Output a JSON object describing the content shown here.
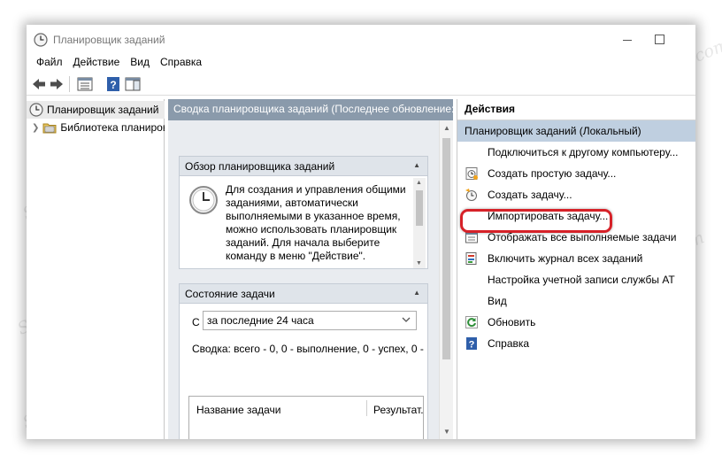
{
  "window": {
    "title": "Планировщик заданий"
  },
  "menubar": {
    "items": [
      "Файл",
      "Действие",
      "Вид",
      "Справка"
    ]
  },
  "toolbar": {
    "buttons": [
      "back-arrow-icon",
      "forward-arrow-icon",
      "console-tree-icon",
      "help-icon",
      "action-pane-icon"
    ]
  },
  "tree": {
    "root_label": "Планировщик заданий",
    "library_label": "Библиотека планировщика заданий"
  },
  "center": {
    "header": "Сводка планировщика заданий (Последнее обновление:",
    "overview": {
      "title": "Обзор планировщика заданий",
      "description": "Для создания и управления общими заданиями, автоматически выполняемыми в указанное время, можно использовать планировщик заданий. Для начала выберите команду в меню \"Действие\"."
    },
    "status": {
      "title": "Состояние задачи",
      "period_label": "С",
      "period_value": "за последние 24 часа",
      "summary": "Сводка: всего - 0, 0 - выполнение, 0 - успех, 0 -",
      "columns": [
        "Название задачи",
        "Результат."
      ]
    }
  },
  "actions": {
    "title": "Действия",
    "group": "Планировщик заданий (Локальный)",
    "items": [
      {
        "label": "Подключиться к другому компьютеру...",
        "icon": "none"
      },
      {
        "label": "Создать простую задачу...",
        "icon": "basic-task-icon"
      },
      {
        "label": "Создать задачу...",
        "icon": "create-task-icon"
      },
      {
        "label": "Импортировать задачу...",
        "icon": "none"
      },
      {
        "label": "Отображать все выполняемые задачи",
        "icon": "running-tasks-icon"
      },
      {
        "label": "Включить журнал всех заданий",
        "icon": "history-log-icon"
      },
      {
        "label": "Настройка учетной записи службы AT",
        "icon": "none"
      },
      {
        "label": "Вид",
        "icon": "none"
      },
      {
        "label": "Обновить",
        "icon": "refresh-icon"
      },
      {
        "label": "Справка",
        "icon": "help-icon"
      }
    ]
  },
  "watermark": "Soringpcrepair.com",
  "colors": {
    "highlight_ring": "#d62128",
    "center_header": "#8a9aab",
    "actions_group": "#bfcfe0"
  }
}
